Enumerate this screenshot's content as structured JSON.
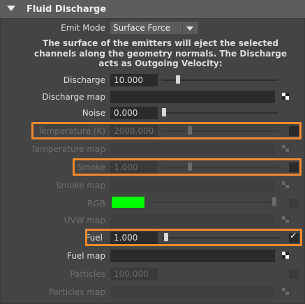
{
  "header": {
    "title": "Fluid Discharge"
  },
  "emit_mode": {
    "label": "Emit Mode",
    "value": "Surface Force"
  },
  "description": "The surface of the emitters will eject the selected channels along the geometry normals. The Discharge acts as Outgoing Velocity:",
  "rows": {
    "discharge": {
      "label": "Discharge",
      "value": "10.000",
      "slider_fraction": 0.12
    },
    "discharge_map": {
      "label": "Discharge map"
    },
    "noise": {
      "label": "Noise",
      "value": "0.000",
      "slider_fraction": 0.0
    },
    "temperature": {
      "label": "Temperature (K)",
      "value": "2000.000",
      "slider_fraction": 0.22
    },
    "temperature_map": {
      "label": "Temperature map"
    },
    "smoke": {
      "label": "Smoke",
      "value": "1.000",
      "slider_fraction": 0.22
    },
    "smoke_map": {
      "label": "Smoke map"
    },
    "rgb": {
      "label": "RGB",
      "color": "#00ff00"
    },
    "uvw_map": {
      "label": "UVW map"
    },
    "fuel": {
      "label": "Fuel",
      "value": "1.000",
      "checked": true,
      "slider_fraction": 0.02
    },
    "fuel_map": {
      "label": "Fuel map"
    },
    "particles": {
      "label": "Particles",
      "value": "100.000"
    },
    "particles_map": {
      "label": "Particles map"
    }
  },
  "colors": {
    "highlight": "#f0892e",
    "panel_bg": "#444444",
    "field_bg": "#2b2b2b"
  }
}
